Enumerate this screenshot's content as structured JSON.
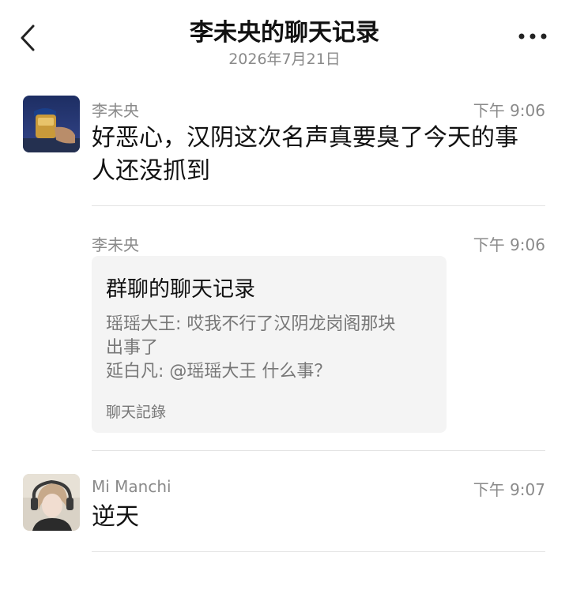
{
  "header": {
    "title": "李未央的聊天记录",
    "date": "2026年7月21日",
    "back_icon": "chevron-left-icon",
    "more_icon": "more-horizontal-icon"
  },
  "messages": [
    {
      "sender": "李未央",
      "time": "下午 9:06",
      "text_lines": [
        "好恶心，汉阴这次名声真要臭了今天的事",
        "人还没抓到"
      ]
    },
    {
      "sender": "李未央",
      "time": "下午 9:06",
      "card": {
        "title": "群聊的聊天记录",
        "lines": [
          "瑶瑶大王: 哎我不行了汉阴龙岗阁那块",
          "出事了",
          "延白凡: @瑶瑶大王 什么事？"
        ],
        "footer": "聊天記錄"
      }
    },
    {
      "sender": "Mi Manchi",
      "time": "下午 9:07",
      "text_lines": [
        "逆天"
      ]
    }
  ],
  "colors": {
    "text_primary": "#111111",
    "text_secondary": "#8a8a8a",
    "card_bg": "#f4f4f4",
    "divider": "#e3e3e3"
  }
}
